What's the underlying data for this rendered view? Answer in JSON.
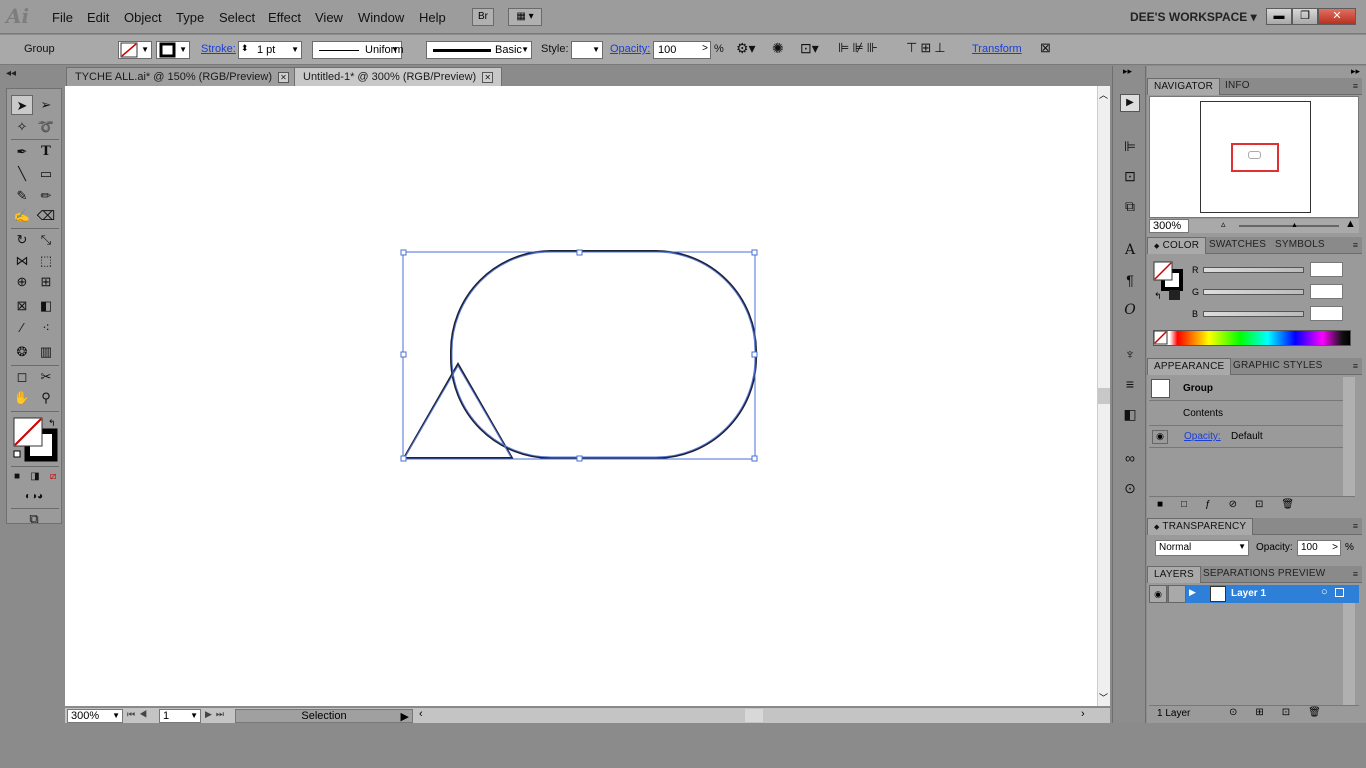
{
  "app": {
    "logo": "Ai",
    "bridge": "Br",
    "workspace": "DEE'S WORKSPACE"
  },
  "menu": [
    "File",
    "Edit",
    "Object",
    "Type",
    "Select",
    "Effect",
    "View",
    "Window",
    "Help"
  ],
  "window_controls": {
    "minimize": "▬",
    "restore": "❐",
    "close": "✕"
  },
  "control": {
    "selection_type": "Group",
    "stroke_label": "Stroke:",
    "stroke_weight": "1 pt",
    "profile": "Uniform",
    "brush": "Basic",
    "style_label": "Style:",
    "opacity_label": "Opacity:",
    "opacity_value": "100",
    "percent": "%",
    "transform": "Transform"
  },
  "tabs": [
    {
      "label": "TYCHE ALL.ai* @ 150% (RGB/Preview)",
      "active": false
    },
    {
      "label": "Untitled-1* @ 300% (RGB/Preview)",
      "active": true
    }
  ],
  "status": {
    "zoom": "300%",
    "page": "1",
    "tool": "Selection"
  },
  "navigator": {
    "tabs": [
      "NAVIGATOR",
      "INFO"
    ],
    "zoom": "300%"
  },
  "color": {
    "tabs": [
      "COLOR",
      "SWATCHES",
      "SYMBOLS"
    ],
    "channels": [
      "R",
      "G",
      "B"
    ]
  },
  "appearance": {
    "tabs": [
      "APPEARANCE",
      "GRAPHIC STYLES"
    ],
    "object": "Group",
    "contents": "Contents",
    "opacity_label": "Opacity:",
    "opacity_value": "Default"
  },
  "transparency": {
    "tab": "TRANSPARENCY",
    "blend_mode": "Normal",
    "opacity_label": "Opacity:",
    "opacity_value": "100",
    "percent": "%"
  },
  "layers": {
    "tabs": [
      "LAYERS",
      "SEPARATIONS PREVIEW"
    ],
    "layer_name": "Layer 1",
    "count": "1 Layer"
  },
  "colors": {
    "selection": "#4a6fd6",
    "layer_highlight": "#2d7fd8",
    "accent_link": "#1a3fd6",
    "navigator_frame": "#e03030"
  }
}
